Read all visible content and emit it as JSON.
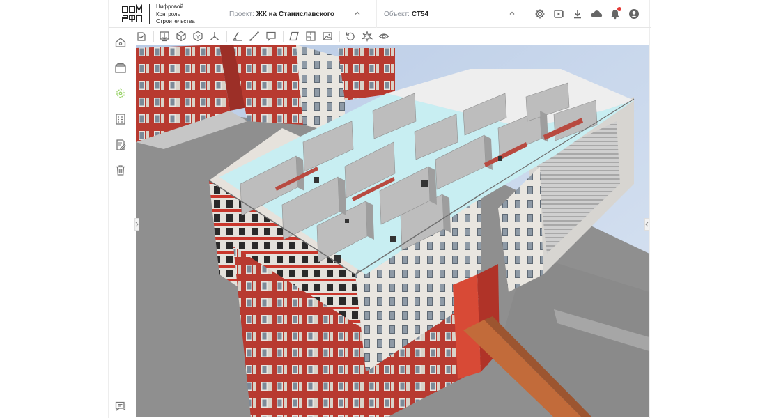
{
  "header": {
    "logo_text": "ДОМ РФ",
    "tagline": [
      "Цифровой",
      "Контроль",
      "Строительства"
    ],
    "project": {
      "label": "Проект:",
      "value": "ЖК на Станиславского"
    },
    "object": {
      "label": "Объект:",
      "value": "СТ54"
    },
    "icons": [
      "settings-icon",
      "video-icon",
      "download-icon",
      "cloud-icon",
      "bell-icon",
      "user-icon"
    ],
    "notification_color": "#e53935"
  },
  "sidebar": {
    "items": [
      "home-icon",
      "layers-icon",
      "model-view-icon",
      "checklist-icon",
      "edit-document-icon",
      "trash-icon"
    ],
    "footer": "chat-icon",
    "active_color": "#9bd36b"
  },
  "toolbar": {
    "tools": [
      "verify-icon",
      "download-section-icon",
      "cube-icon",
      "cube-outline-icon",
      "axes-icon",
      "angle-measure-icon",
      "line-measure-icon",
      "comment-icon",
      "plane-icon",
      "section-box-icon",
      "image-icon",
      "reset-icon",
      "explode-icon",
      "visibility-icon"
    ]
  },
  "viewport": {
    "content": "3D BIM model of multi-storey residential building",
    "sky_color": "#c9d8ea",
    "ground_color": "#8f8f8f",
    "accent_color": "#c0392b"
  }
}
